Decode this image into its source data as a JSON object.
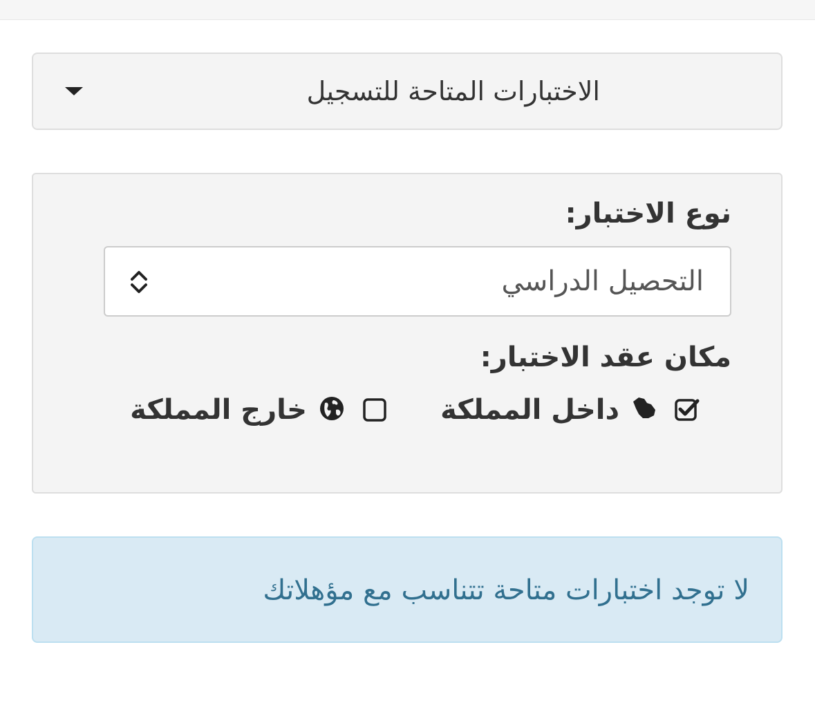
{
  "dropdown": {
    "title": "الاختبارات المتاحة للتسجيل"
  },
  "filters": {
    "type_label": "نوع الاختبار:",
    "type_select_value": "التحصيل الدراسي",
    "place_label": "مكان عقد الاختبار:",
    "options": [
      {
        "label": "داخل المملكة",
        "checked": true,
        "icon": "saudi-map-icon"
      },
      {
        "label": "خارج المملكة",
        "checked": false,
        "icon": "globe-icon"
      }
    ]
  },
  "alert": {
    "message": "لا توجد اختبارات متاحة تتناسب مع مؤهلاتك"
  },
  "colors": {
    "alert_text": "#31708f",
    "alert_bg": "#d9eaf4",
    "panel_bg": "#f4f4f4"
  }
}
